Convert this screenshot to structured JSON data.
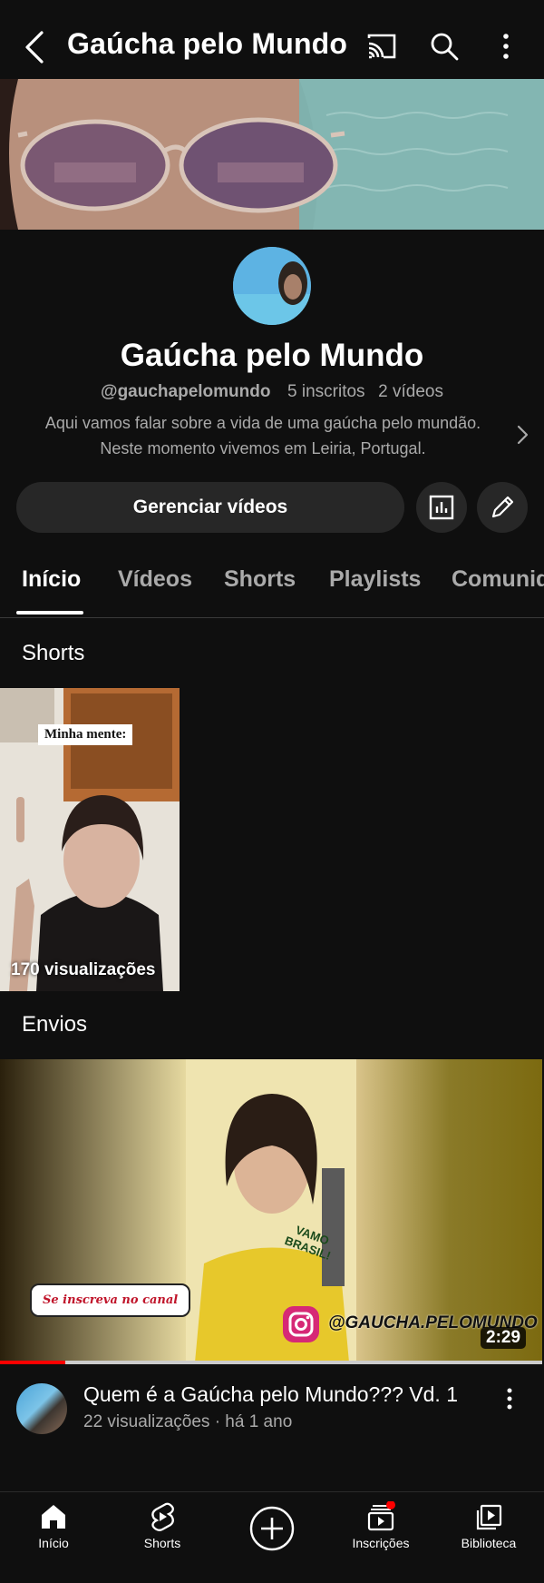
{
  "header": {
    "title": "Gaúcha pelo Mundo"
  },
  "channel": {
    "name": "Gaúcha pelo Mundo",
    "handle": "@gauchapelomundo",
    "subscribers": "5 inscritos",
    "videos": "2 vídeos",
    "description_line1": "Aqui vamos falar sobre a vida de uma gaúcha pelo mundão.",
    "description_line2": "Neste momento vivemos em Leiria, Portugal.",
    "manage_button": "Gerenciar vídeos"
  },
  "tabs": [
    {
      "label": "Início",
      "active": true
    },
    {
      "label": "Vídeos",
      "active": false
    },
    {
      "label": "Shorts",
      "active": false
    },
    {
      "label": "Playlists",
      "active": false
    },
    {
      "label": "Comunid",
      "active": false
    }
  ],
  "sections": {
    "shorts_title": "Shorts",
    "uploads_title": "Envios"
  },
  "shorts": [
    {
      "overlay_text": "Minha mente:",
      "views": "170 visualizações"
    }
  ],
  "uploads": [
    {
      "title": "Quem é a Gaúcha pelo Mundo??? Vd. 1",
      "meta": "22 visualizações · há 1 ano",
      "duration": "2:29",
      "watched_fraction": 0.12,
      "thumb_caption": "Se inscreva no canal",
      "thumb_handle": "@GAUCHA.PELOMUNDO",
      "shirt_text": "VAMO BRASIL!"
    }
  ],
  "bottom_nav": [
    {
      "label": "Início",
      "icon": "home-icon"
    },
    {
      "label": "Shorts",
      "icon": "shorts-icon"
    },
    {
      "label": "",
      "icon": "create-icon"
    },
    {
      "label": "Inscrições",
      "icon": "subscriptions-icon",
      "badge": true
    },
    {
      "label": "Biblioteca",
      "icon": "library-icon"
    }
  ],
  "colors": {
    "background": "#0f0f0f",
    "surface": "#272727",
    "secondary_text": "#aaaaaa",
    "accent_red": "#ff0000"
  }
}
